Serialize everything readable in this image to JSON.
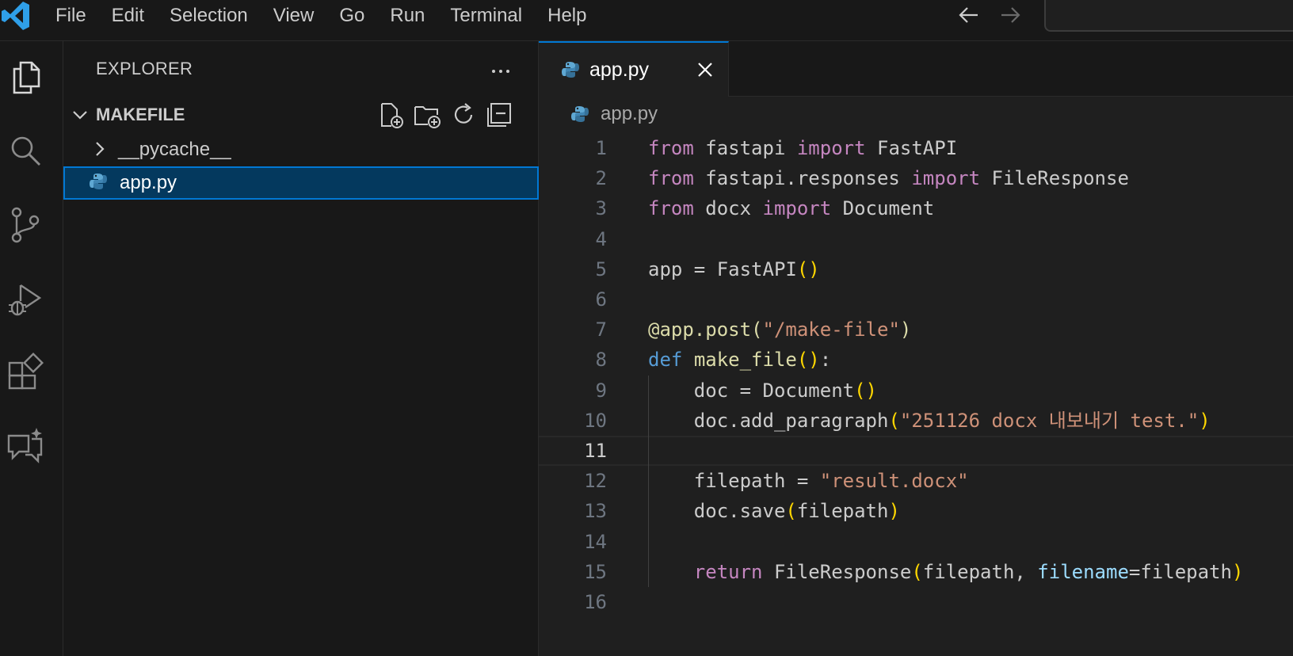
{
  "menu": [
    "File",
    "Edit",
    "Selection",
    "View",
    "Go",
    "Run",
    "Terminal",
    "Help"
  ],
  "sidebar": {
    "title": "EXPLORER",
    "section": "MAKEFILE",
    "items": [
      {
        "label": "__pycache__",
        "type": "folder",
        "expanded": false
      },
      {
        "label": "app.py",
        "type": "python-file",
        "selected": true
      }
    ]
  },
  "editor": {
    "tab_label": "app.py",
    "breadcrumb": "app.py",
    "current_line": 11,
    "lines": [
      [
        {
          "t": "from",
          "c": "kw"
        },
        {
          "t": " fastapi ",
          "c": "plain"
        },
        {
          "t": "import",
          "c": "kw"
        },
        {
          "t": " FastAPI",
          "c": "plain"
        }
      ],
      [
        {
          "t": "from",
          "c": "kw"
        },
        {
          "t": " fastapi.responses ",
          "c": "plain"
        },
        {
          "t": "import",
          "c": "kw"
        },
        {
          "t": " FileResponse",
          "c": "plain"
        }
      ],
      [
        {
          "t": "from",
          "c": "kw"
        },
        {
          "t": " docx ",
          "c": "plain"
        },
        {
          "t": "import",
          "c": "kw"
        },
        {
          "t": " Document",
          "c": "plain"
        }
      ],
      [],
      [
        {
          "t": "app = FastAPI",
          "c": "plain"
        },
        {
          "t": "()",
          "c": "br"
        }
      ],
      [],
      [
        {
          "t": "@app.post(",
          "c": "fn"
        },
        {
          "t": "\"/make-file\"",
          "c": "str"
        },
        {
          "t": ")",
          "c": "fn"
        }
      ],
      [
        {
          "t": "def",
          "c": "def"
        },
        {
          "t": " ",
          "c": "plain"
        },
        {
          "t": "make_file",
          "c": "fn"
        },
        {
          "t": "()",
          "c": "br"
        },
        {
          "t": ":",
          "c": "plain"
        }
      ],
      [
        {
          "t": "    doc = Document",
          "c": "plain"
        },
        {
          "t": "()",
          "c": "br"
        }
      ],
      [
        {
          "t": "    doc.add_paragraph",
          "c": "plain"
        },
        {
          "t": "(",
          "c": "br"
        },
        {
          "t": "\"251126 docx 내보내기 test.\"",
          "c": "str"
        },
        {
          "t": ")",
          "c": "br"
        }
      ],
      [],
      [
        {
          "t": "    filepath = ",
          "c": "plain"
        },
        {
          "t": "\"result.docx\"",
          "c": "str"
        }
      ],
      [
        {
          "t": "    doc.save",
          "c": "plain"
        },
        {
          "t": "(",
          "c": "br"
        },
        {
          "t": "filepath",
          "c": "plain"
        },
        {
          "t": ")",
          "c": "br"
        }
      ],
      [],
      [
        {
          "t": "    ",
          "c": "plain"
        },
        {
          "t": "return",
          "c": "kw"
        },
        {
          "t": " FileResponse",
          "c": "plain"
        },
        {
          "t": "(",
          "c": "br"
        },
        {
          "t": "filepath, ",
          "c": "plain"
        },
        {
          "t": "filename",
          "c": "param"
        },
        {
          "t": "=filepath",
          "c": "plain"
        },
        {
          "t": ")",
          "c": "br"
        }
      ],
      []
    ]
  },
  "activity_icons": [
    "explorer-icon",
    "search-icon",
    "source-control-icon",
    "run-debug-icon",
    "extensions-icon",
    "chat-icon"
  ],
  "colors": {
    "accent": "#0078d4",
    "keyword": "#c586c0",
    "string": "#ce9178",
    "function": "#dcdcaa",
    "bracket": "#ffd700",
    "selection_bg": "#04395e"
  }
}
